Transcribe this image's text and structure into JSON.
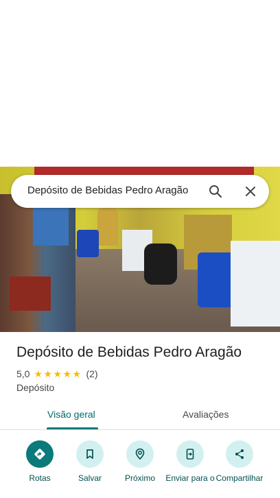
{
  "search": {
    "query": "Depósito de Bebidas Pedro Aragão"
  },
  "place": {
    "name": "Depósito de Bebidas Pedro Aragão",
    "rating": "5,0",
    "stars": 5,
    "review_count": "(2)",
    "category": "Depósito"
  },
  "tabs": [
    {
      "label": "Visão geral",
      "selected": true
    },
    {
      "label": "Avaliações",
      "selected": false
    }
  ],
  "actions": [
    {
      "label": "Rotas",
      "icon": "directions-icon"
    },
    {
      "label": "Salvar",
      "icon": "bookmark-icon"
    },
    {
      "label": "Próximo",
      "icon": "nearby-icon"
    },
    {
      "label": "Enviar para o",
      "icon": "send-to-phone-icon"
    },
    {
      "label": "Compartilhar",
      "icon": "share-icon"
    }
  ],
  "colors": {
    "accent": "#0b7a7a",
    "accent_light": "#d3f0f0",
    "star": "#f8bd00",
    "tab_active": "#006a6a"
  }
}
